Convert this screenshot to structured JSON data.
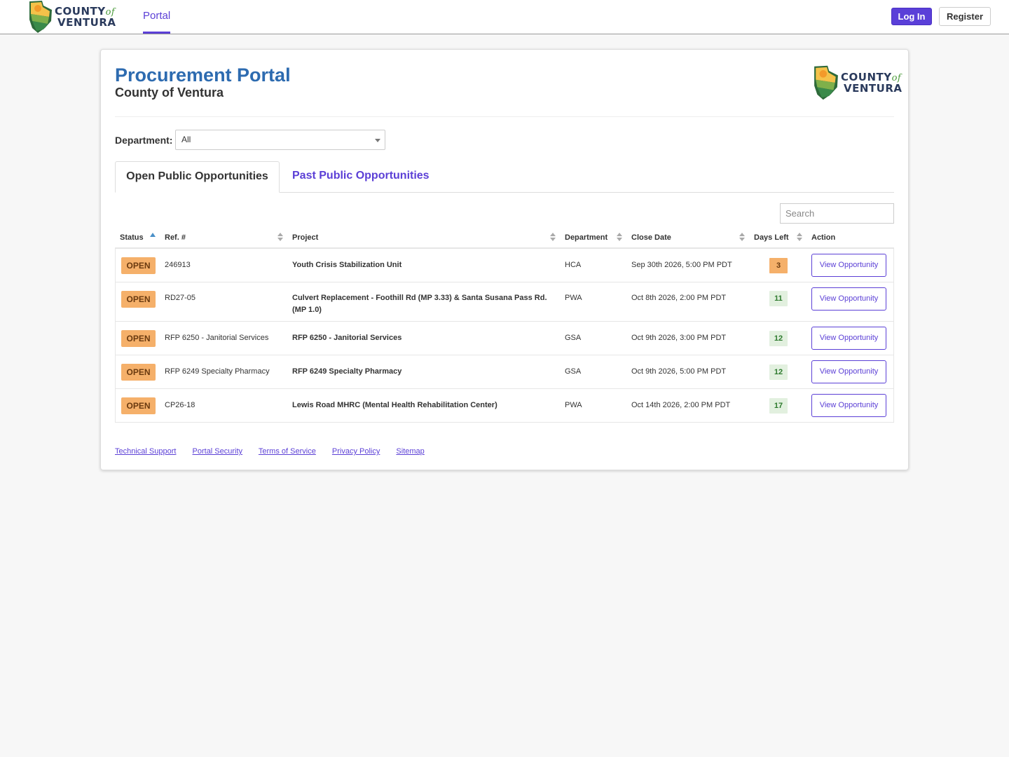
{
  "nav": {
    "logo_text_1": "COUNTY",
    "logo_text_of": "of",
    "logo_text_2": "VENTURA",
    "portal_label": "Portal",
    "login_label": "Log In",
    "register_label": "Register"
  },
  "header": {
    "title": "Procurement Portal",
    "subtitle": "County of Ventura"
  },
  "filter": {
    "department_label": "Department:",
    "department_value": "All"
  },
  "tabs": [
    {
      "label": "Open Public Opportunities",
      "active": true
    },
    {
      "label": "Past Public Opportunities",
      "active": false
    }
  ],
  "search": {
    "placeholder": "Search"
  },
  "table": {
    "columns": [
      "Status",
      "Ref. #",
      "Project",
      "Department",
      "Close Date",
      "Days Left",
      "Action"
    ],
    "rows": [
      {
        "status": "OPEN",
        "ref": "246913",
        "project": "Youth Crisis Stabilization Unit",
        "dept": "HCA",
        "close": "Sep 30th 2026, 5:00 PM PDT",
        "days": "3",
        "action": "View Opportunity"
      },
      {
        "status": "OPEN",
        "ref": "RD27-05",
        "project": "Culvert Replacement - Foothill Rd (MP 3.33) & Santa Susana Pass Rd. (MP 1.0)",
        "dept": "PWA",
        "close": "Oct 8th 2026, 2:00 PM PDT",
        "days": "11",
        "action": "View Opportunity"
      },
      {
        "status": "OPEN",
        "ref": "RFP 6250 - Janitorial Services",
        "project": "RFP 6250 - Janitorial Services",
        "dept": "GSA",
        "close": "Oct 9th 2026, 3:00 PM PDT",
        "days": "12",
        "action": "View Opportunity"
      },
      {
        "status": "OPEN",
        "ref": "RFP 6249 Specialty Pharmacy",
        "project": "RFP 6249 Specialty Pharmacy",
        "dept": "GSA",
        "close": "Oct 9th 2026, 5:00 PM PDT",
        "days": "12",
        "action": "View Opportunity"
      },
      {
        "status": "OPEN",
        "ref": "CP26-18",
        "project": "Lewis Road MHRC (Mental Health Rehabilitation Center)",
        "dept": "PWA",
        "close": "Oct 14th 2026, 2:00 PM PDT",
        "days": "17",
        "action": "View Opportunity"
      }
    ]
  },
  "footer": {
    "links": [
      "Technical Support",
      "Portal Security",
      "Terms of Service",
      "Privacy Policy",
      "Sitemap"
    ]
  },
  "colors": {
    "accent": "#5b3fd6",
    "title_blue": "#2d6bb0",
    "open_badge": "#f5b06a",
    "days_ok": "#e2f0df"
  }
}
